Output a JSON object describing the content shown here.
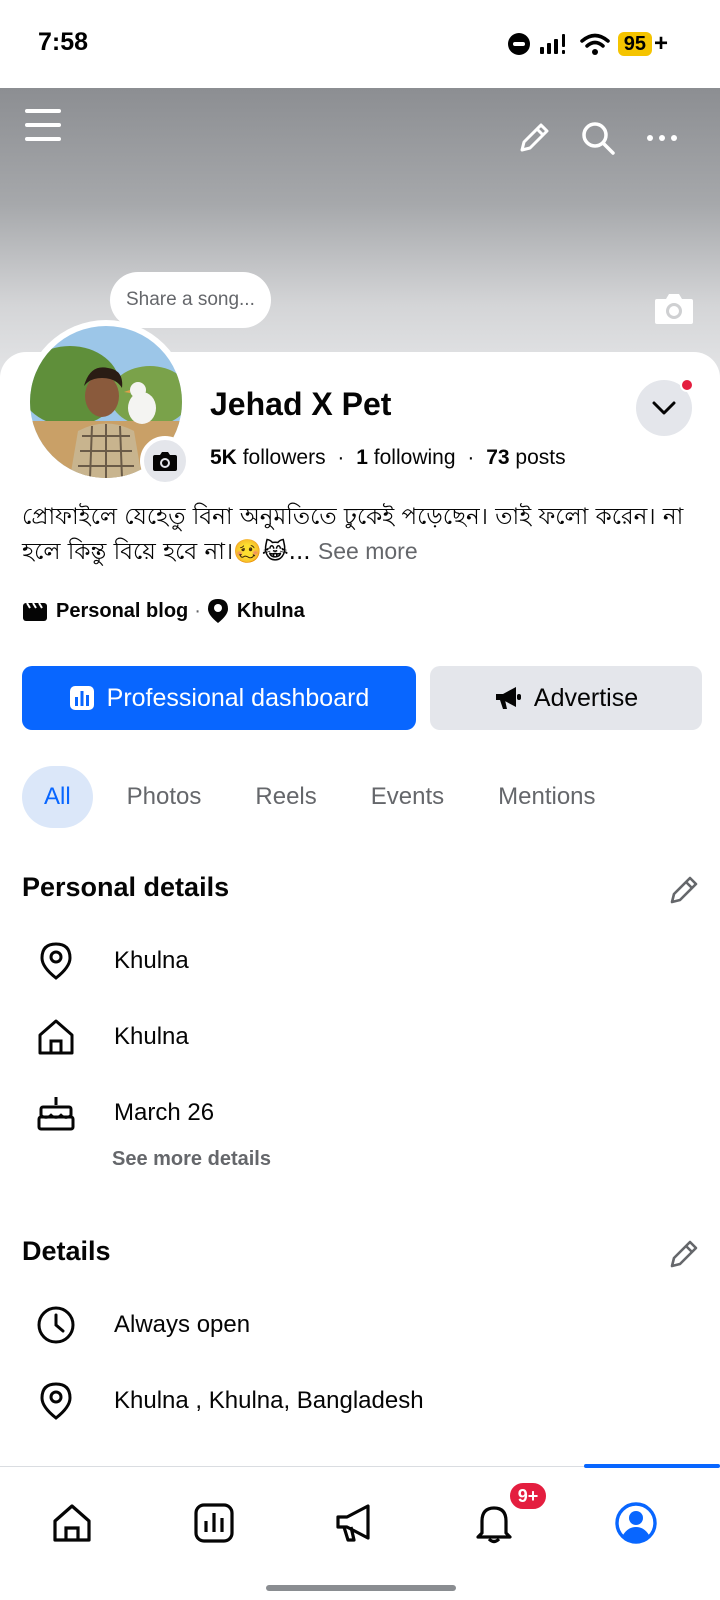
{
  "status_bar": {
    "time": "7:58",
    "battery": "95",
    "battery_suffix": "+"
  },
  "cover": {
    "icons": [
      "menu-icon",
      "pencil-icon",
      "search-icon",
      "more-icon",
      "camera-icon"
    ],
    "colors": {
      "top": "#8c8e92",
      "bottom": "#e4e5e7"
    }
  },
  "song_bubble": {
    "placeholder": "Share a song..."
  },
  "profile": {
    "name": "Jehad X Pet",
    "stats": {
      "followers_count": "5K",
      "followers_label": "followers",
      "following_count": "1",
      "following_label": "following",
      "posts_count": "73",
      "posts_label": "posts",
      "separator": "·"
    },
    "bio": "প্রোফাইলে যেহেতু বিনা অনুমতিতে ঢুকেই পড়েছেন। তাই ফলো করেন। না হলে কিন্তু বিয়ে হবে না।🥴😹...",
    "bio_see_more": "See more",
    "category": "Personal blog",
    "location": "Khulna",
    "meta_separator": "·"
  },
  "actions": {
    "primary_label": "Professional dashboard",
    "secondary_label": "Advertise",
    "accent": "#0866ff"
  },
  "tabs": [
    {
      "label": "All",
      "active": true
    },
    {
      "label": "Photos",
      "active": false
    },
    {
      "label": "Reels",
      "active": false
    },
    {
      "label": "Events",
      "active": false
    },
    {
      "label": "Mentions",
      "active": false
    }
  ],
  "personal_details": {
    "title": "Personal details",
    "items": [
      {
        "icon": "location-pin-icon",
        "text": "Khulna"
      },
      {
        "icon": "home-icon",
        "text": "Khulna"
      },
      {
        "icon": "birthday-cake-icon",
        "text": "March 26"
      }
    ],
    "see_more": "See more details"
  },
  "details": {
    "title": "Details",
    "items": [
      {
        "icon": "clock-icon",
        "text": "Always open"
      },
      {
        "icon": "location-pin-icon",
        "text": "Khulna , Khulna, Bangladesh"
      }
    ]
  },
  "bottom_nav": {
    "items": [
      "home-icon",
      "dashboard-icon",
      "megaphone-icon",
      "notifications-icon",
      "profile-icon"
    ],
    "notification_badge": "9+",
    "active": "profile-icon"
  }
}
